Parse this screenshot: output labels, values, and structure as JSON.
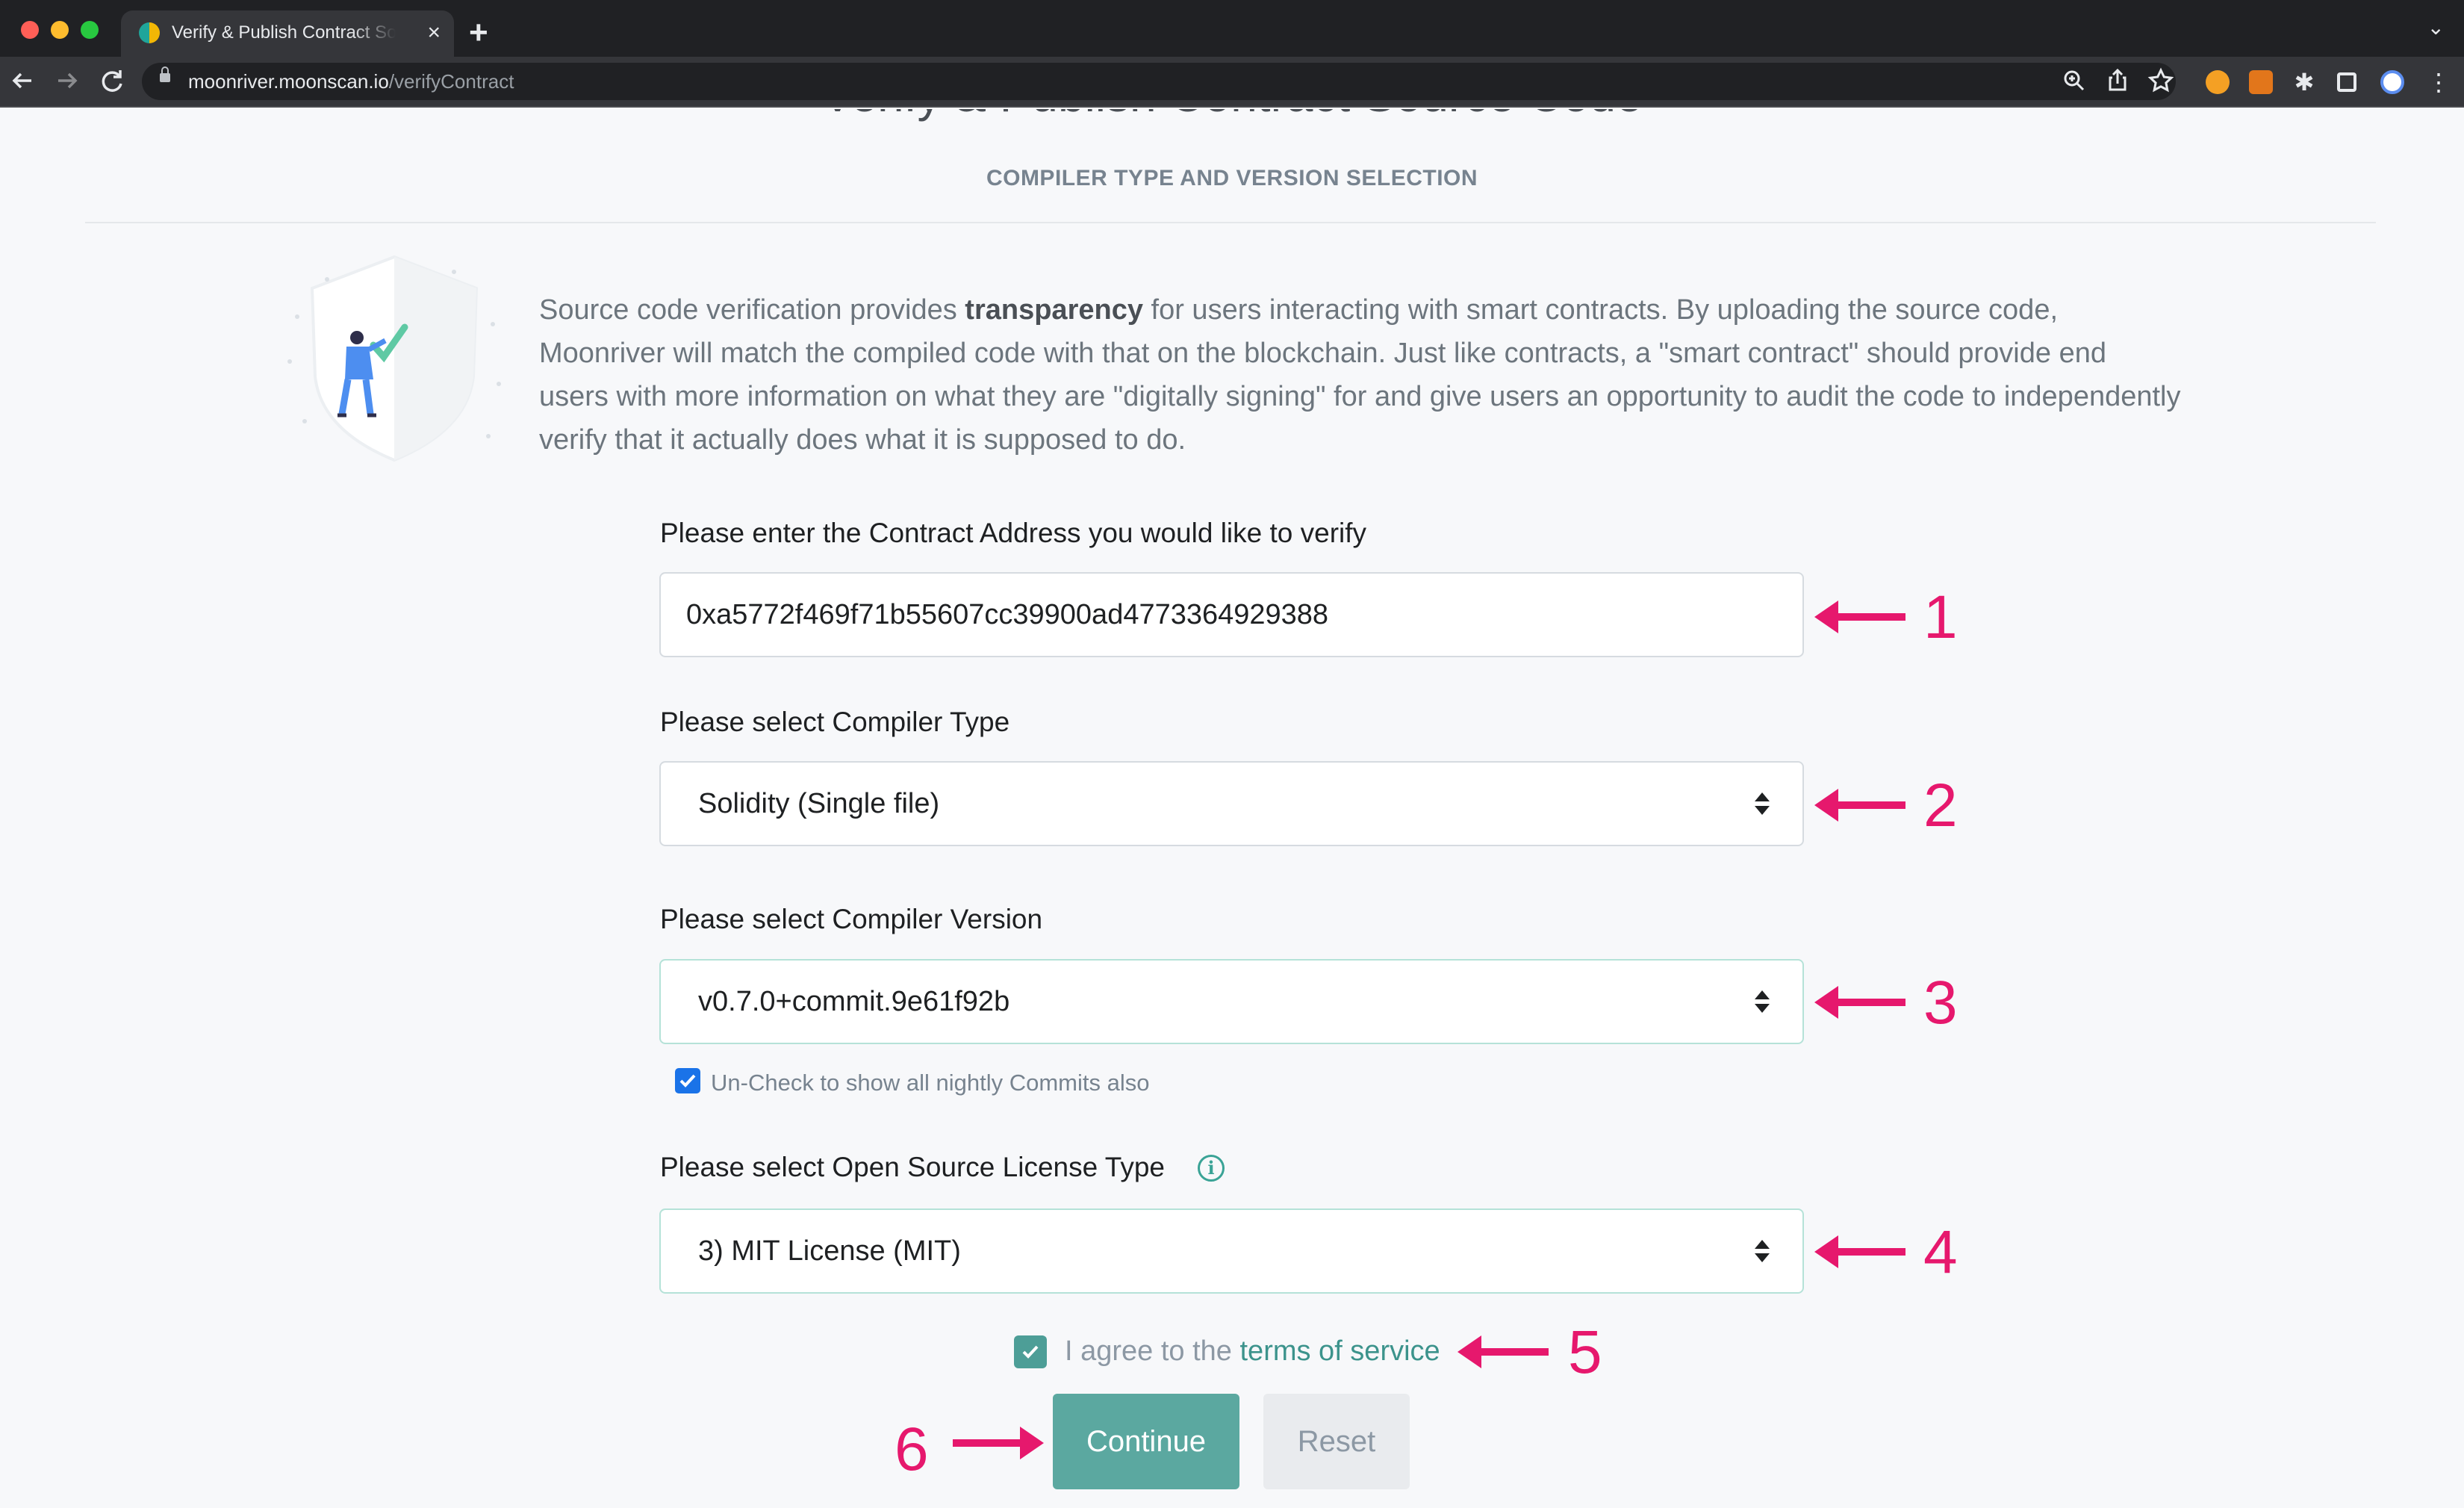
{
  "browser": {
    "tab_title": "Verify & Publish Contract Source Code",
    "tab_close": "×",
    "new_tab": "+",
    "url_host": "moonriver.moonscan.io",
    "url_path": "/verifyContract"
  },
  "page": {
    "title": "Verify & Publish Contract Source Code",
    "subtitle": "COMPILER TYPE AND VERSION SELECTION",
    "intro_before": "Source code verification provides ",
    "intro_bold": "transparency",
    "intro_after": " for users interacting with smart contracts. By uploading the source code, Moonriver will match the compiled code with that on the blockchain. Just like contracts, a \"smart contract\" should provide end users with more information on what they are \"digitally signing\" for and give users an opportunity to audit the code to independently verify that it actually does what it is supposed to do."
  },
  "form": {
    "address_label": "Please enter the Contract Address you would like to verify",
    "address_value": "0xa5772f469f71b55607cc39900ad4773364929388",
    "compiler_type_label": "Please select Compiler Type",
    "compiler_type_value": "Solidity (Single file)",
    "compiler_version_label": "Please select Compiler Version",
    "compiler_version_value": "v0.7.0+commit.9e61f92b",
    "nightly_checkbox_label": "Un-Check to show all nightly Commits also",
    "nightly_checked": true,
    "license_label": "Please select Open Source License Type",
    "license_value": "3) MIT License (MIT)",
    "agree_prefix": "I agree to the ",
    "agree_link": "terms of service",
    "agree_checked": true,
    "continue_label": "Continue",
    "reset_label": "Reset"
  },
  "annotations": {
    "color": "#e6186d",
    "labels": [
      "1",
      "2",
      "3",
      "4",
      "5",
      "6"
    ]
  },
  "icons": {
    "back": "arrow-left-icon",
    "forward": "arrow-right-icon",
    "reload": "reload-icon",
    "zoom": "zoom-icon",
    "share": "share-icon",
    "bookmark": "star-icon",
    "info": "info-icon"
  }
}
